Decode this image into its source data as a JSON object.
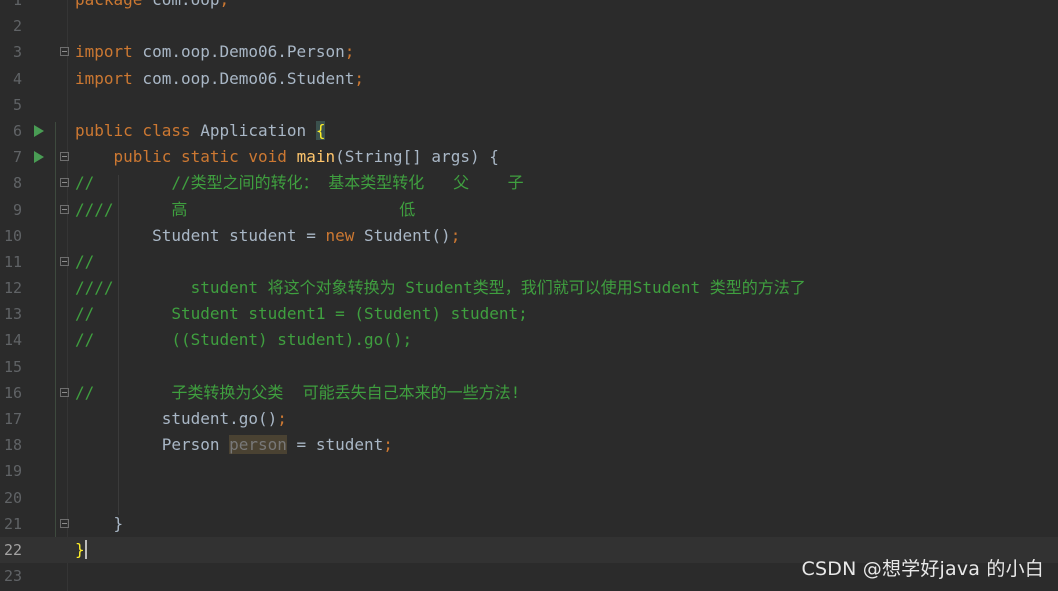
{
  "lines": [
    {
      "n": "1",
      "segs": [
        [
          "kw",
          "package"
        ],
        [
          "cls",
          " com.oop"
        ],
        [
          "semi",
          ";"
        ]
      ]
    },
    {
      "n": "2",
      "segs": []
    },
    {
      "n": "3",
      "fold": true,
      "segs": [
        [
          "kw",
          "import"
        ],
        [
          "cls",
          " com.oop.Demo06.Person"
        ],
        [
          "semi",
          ";"
        ]
      ]
    },
    {
      "n": "4",
      "segs": [
        [
          "kw",
          "import"
        ],
        [
          "cls",
          " com.oop.Demo06.Student"
        ],
        [
          "semi",
          ";"
        ]
      ]
    },
    {
      "n": "5",
      "segs": []
    },
    {
      "n": "6",
      "run": true,
      "segs": [
        [
          "kw",
          "public class"
        ],
        [
          "cls",
          " Application "
        ],
        [
          "brace-hl",
          "{"
        ]
      ]
    },
    {
      "n": "7",
      "run": true,
      "fold": true,
      "segs": [
        [
          "cls",
          "    "
        ],
        [
          "kw",
          "public static void"
        ],
        [
          "cls",
          " "
        ],
        [
          "fn",
          "main"
        ],
        [
          "cls",
          "(String[] args) {"
        ]
      ]
    },
    {
      "n": "8",
      "fold": true,
      "segs": [
        [
          "cm-line",
          "//        //类型之间的转化： 基本类型转化   父    子"
        ]
      ]
    },
    {
      "n": "9",
      "fold": true,
      "segs": [
        [
          "cm-line",
          "////      高                      低"
        ]
      ]
    },
    {
      "n": "10",
      "segs": [
        [
          "cls",
          "        Student student = "
        ],
        [
          "kw",
          "new"
        ],
        [
          "cls",
          " Student()"
        ],
        [
          "semi",
          ";"
        ]
      ]
    },
    {
      "n": "11",
      "fold": true,
      "segs": [
        [
          "cm-line",
          "//"
        ]
      ]
    },
    {
      "n": "12",
      "segs": [
        [
          "cm-line",
          "////        student 将这个对象转换为 Student类型，我们就可以使用Student 类型的方法了"
        ]
      ]
    },
    {
      "n": "13",
      "segs": [
        [
          "cm-line",
          "//        Student student1 = (Student) student;"
        ]
      ]
    },
    {
      "n": "14",
      "segs": [
        [
          "cm-line",
          "//        ((Student) student).go();"
        ]
      ]
    },
    {
      "n": "15",
      "segs": []
    },
    {
      "n": "16",
      "fold": true,
      "segs": [
        [
          "cm-line",
          "//        子类转换为父类  可能丢失自己本来的一些方法!"
        ]
      ]
    },
    {
      "n": "17",
      "segs": [
        [
          "cls",
          "         student.go()"
        ],
        [
          "semi",
          ";"
        ]
      ]
    },
    {
      "n": "18",
      "segs": [
        [
          "cls",
          "         Person "
        ],
        [
          "unused",
          "person"
        ],
        [
          "cls",
          " = student"
        ],
        [
          "semi",
          ";"
        ]
      ]
    },
    {
      "n": "19",
      "segs": []
    },
    {
      "n": "20",
      "segs": []
    },
    {
      "n": "21",
      "fold": true,
      "segs": [
        [
          "cls",
          "    }"
        ]
      ]
    },
    {
      "n": "22",
      "current": true,
      "segs": [
        [
          "caret-brace",
          "}"
        ]
      ]
    },
    {
      "n": "23",
      "segs": []
    }
  ],
  "watermark": "CSDN @想学好java 的小白"
}
